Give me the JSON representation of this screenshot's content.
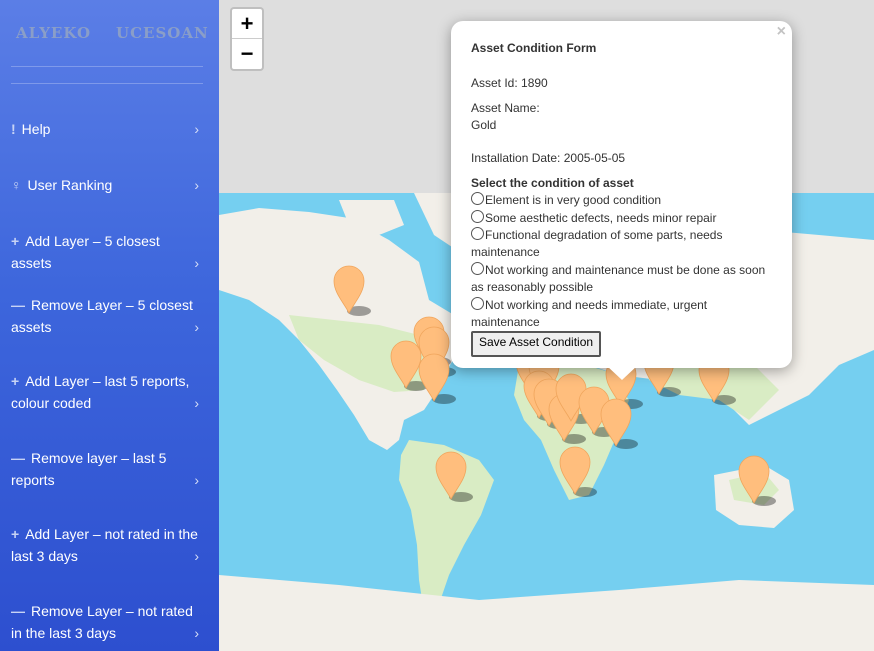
{
  "brand": {
    "left": "ALYEKO",
    "right": "UCESOAN"
  },
  "sidebar": {
    "items": [
      {
        "icon": "!",
        "label": "Help"
      },
      {
        "icon": "♀",
        "label": "User Ranking"
      },
      {
        "icon": "+",
        "label": "Add Layer – 5 closest assets"
      },
      {
        "icon": "—",
        "label": "Remove Layer – 5 closest assets"
      },
      {
        "icon": "+",
        "label": "Add Layer – last 5 reports, colour coded"
      },
      {
        "icon": "—",
        "label": "Remove layer – last 5 reports"
      },
      {
        "icon": "+",
        "label": "Add Layer – not rated in the last 3 days"
      },
      {
        "icon": "—",
        "label": "Remove Layer – not rated in the last 3 days"
      }
    ],
    "chevron": "›"
  },
  "zoom": {
    "in": "+",
    "out": "−"
  },
  "popup": {
    "close": "×",
    "title": "Asset Condition Form",
    "asset_id": "Asset Id: 1890",
    "asset_name_label": "Asset Name:",
    "asset_name": "Gold",
    "installation_date": "Installation Date: 2005-05-05",
    "question": "Select the condition of asset",
    "options": [
      "Element is in very good condition",
      "Some aesthetic defects, needs minor repair",
      "Functional degradation of some parts, needs maintenance",
      "Not working and maintenance must be done as soon as reasonably possible",
      "Not working and needs immediate, urgent maintenance"
    ],
    "save_label": "Save Asset Condition"
  },
  "colors": {
    "ocean": "#75cff0",
    "land": "#f2efe9",
    "green": "#d9ecc4",
    "marker": "#ffbe7d",
    "sidebar": "#3d66dc"
  }
}
